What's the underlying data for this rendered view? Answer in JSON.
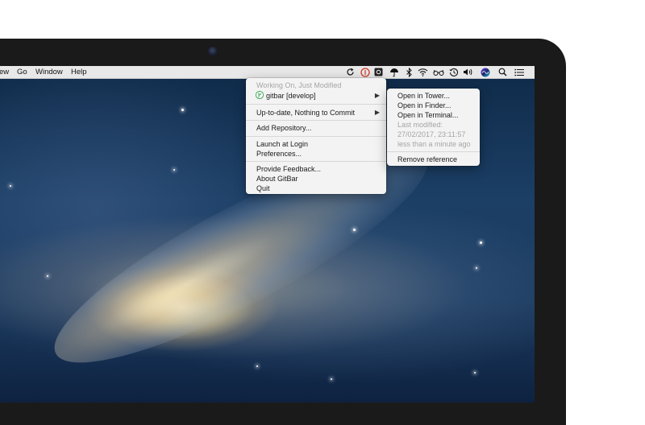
{
  "menubar": {
    "left_items": [
      "ew",
      "Go",
      "Window",
      "Help"
    ],
    "status_icons": [
      "sync-icon",
      "gitbar-icon",
      "dark-square-icon",
      "umbrella-icon",
      "bluetooth-icon",
      "wifi-icon",
      "glasses-icon",
      "time-machine-icon",
      "volume-icon",
      "siri-icon",
      "spotlight-icon",
      "notification-center-icon"
    ]
  },
  "main_menu": {
    "header": "Working On, Just Modified",
    "repo": "gitbar [develop]",
    "uptodate": "Up-to-date, Nothing to Commit",
    "add_repo": "Add Repository...",
    "launch": "Launch at Login",
    "prefs": "Preferences...",
    "feedback": "Provide Feedback...",
    "about": "About GitBar",
    "quit": "Quit"
  },
  "submenu": {
    "open_tower": "Open in Tower...",
    "open_finder": "Open in Finder...",
    "open_terminal": "Open in Terminal...",
    "last_modified_label": "Last modified:",
    "last_modified_date": "27/02/2017, 23:11:57",
    "last_modified_rel": "less than a minute ago",
    "remove": "Remove reference"
  },
  "colors": {
    "gitbar_accent": "#3aa556",
    "menubar_bg": "#e8e8e8",
    "menu_bg": "#f3f3f3",
    "dim_text": "#a5a5a5"
  }
}
